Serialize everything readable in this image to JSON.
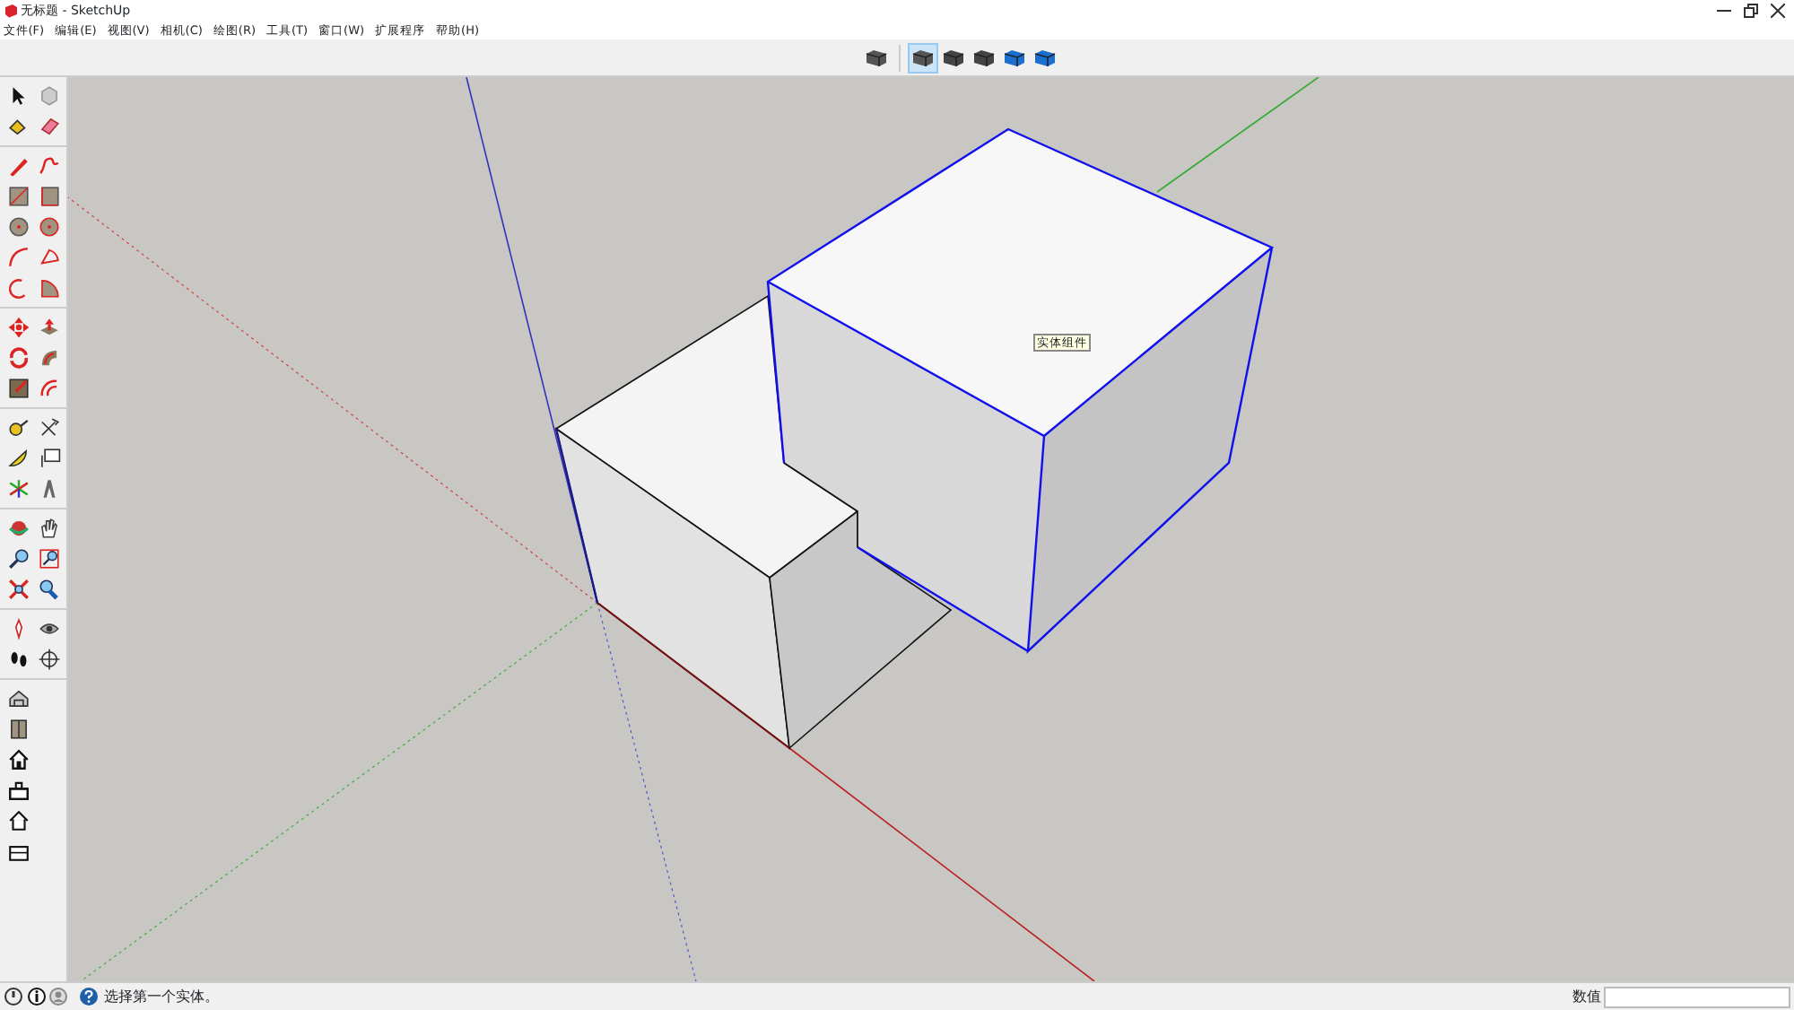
{
  "window": {
    "title": "无标题 - SketchUp"
  },
  "menu": [
    "文件(F)",
    "编辑(E)",
    "视图(V)",
    "相机(C)",
    "绘图(R)",
    "工具(T)",
    "窗口(W)",
    "扩展程序",
    "帮助(H)"
  ],
  "view_toolbar": [
    {
      "selected": false
    },
    {
      "selected": true
    },
    {
      "selected": false
    },
    {
      "selected": false
    },
    {
      "selected": false
    },
    {
      "selected": false
    }
  ],
  "canvas": {
    "tooltip": "实体组件"
  },
  "status_bar": {
    "message": "选择第一个实体。",
    "measurements_label": "数值"
  }
}
